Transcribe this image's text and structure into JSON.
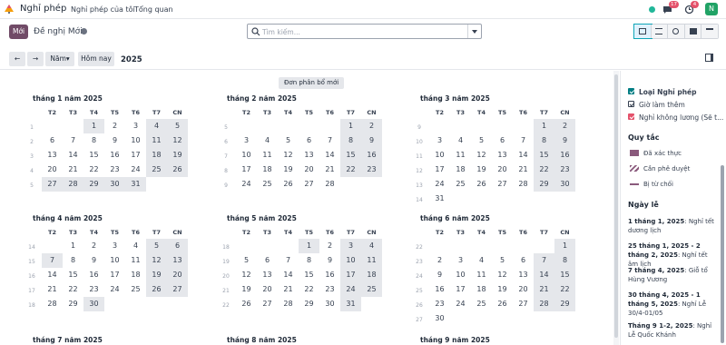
{
  "nav": {
    "app_name": "Nghỉ phép",
    "menu": [
      "Nghỉ phép của tôi",
      "Tổng quan"
    ],
    "chat_badge": "17",
    "activity_badge": "4",
    "avatar_letter": "N",
    "colors": {
      "online": "#21b799",
      "badge": "#e4526b",
      "avatar": "#21a366"
    }
  },
  "control": {
    "new_label": "Mới",
    "breadcrumb": "Đề nghị Mới",
    "search_placeholder": "Tìm kiếm...",
    "scale_label": "Năm",
    "today_label": "Hôm nay",
    "year": "2025",
    "views": [
      "calendar-view",
      "list-view",
      "activity-view",
      "pivot-view",
      "gantt-view"
    ]
  },
  "calendar": {
    "allocation_button": "Đơn phân bổ mới",
    "weekdays": [
      "T2",
      "T3",
      "T4",
      "T5",
      "T6",
      "T7",
      "CN"
    ],
    "months": [
      {
        "title": "tháng 1 năm 2025",
        "offset": 2,
        "days": 31,
        "weeks": [
          "1",
          "2",
          "3",
          "4",
          "5"
        ],
        "holidays": [
          1,
          25,
          26,
          27,
          28,
          29,
          30,
          31
        ]
      },
      {
        "title": "tháng 2 năm 2025",
        "offset": 5,
        "days": 28,
        "weeks": [
          "5",
          "6",
          "7",
          "8",
          "9"
        ],
        "holidays": []
      },
      {
        "title": "tháng 3 năm 2025",
        "offset": 5,
        "days": 31,
        "weeks": [
          "9",
          "10",
          "11",
          "12",
          "13",
          "14"
        ],
        "holidays": []
      },
      {
        "title": "tháng 4 năm 2025",
        "offset": 1,
        "days": 30,
        "weeks": [
          "14",
          "15",
          "16",
          "17",
          "18"
        ],
        "holidays": [
          7,
          30
        ]
      },
      {
        "title": "tháng 5 năm 2025",
        "offset": 3,
        "days": 31,
        "weeks": [
          "18",
          "19",
          "20",
          "21",
          "22"
        ],
        "holidays": [
          1
        ]
      },
      {
        "title": "tháng 6 năm 2025",
        "offset": 6,
        "days": 30,
        "weeks": [
          "22",
          "23",
          "24",
          "25",
          "26",
          "27"
        ],
        "holidays": []
      }
    ],
    "next_titles": [
      "tháng 7 năm 2025",
      "tháng 8 năm 2025",
      "tháng 9 năm 2025"
    ]
  },
  "filters": {
    "types": [
      {
        "label": "Loại Nghỉ phép",
        "bold": true
      },
      {
        "label": "Giờ làm thêm",
        "bold": false
      },
      {
        "label": "Nghỉ không lương (Sẽ t...",
        "bold": false
      }
    ],
    "legend_title": "Quy tắc",
    "legend": [
      "Đã xác thực",
      "Cần phê duyệt",
      "Bị từ chối"
    ],
    "holidays_title": "Ngày lễ",
    "holidays": [
      {
        "date": "1 tháng 1, 2025",
        "name": ": Nghỉ tết dương lịch"
      },
      {
        "date": "25 tháng 1, 2025 - 2 tháng 2, 2025",
        "name": ": Nghỉ tết âm lịch"
      },
      {
        "date": "7 tháng 4, 2025",
        "name": ": Giỗ tổ Hùng Vương"
      },
      {
        "date": "30 tháng 4, 2025 - 1 tháng 5, 2025",
        "name": ": Nghỉ Lễ 30/4-01/05"
      },
      {
        "date": "Tháng 9 1-2, 2025",
        "name": ": Nghỉ Lễ Quốc Khánh"
      }
    ]
  }
}
